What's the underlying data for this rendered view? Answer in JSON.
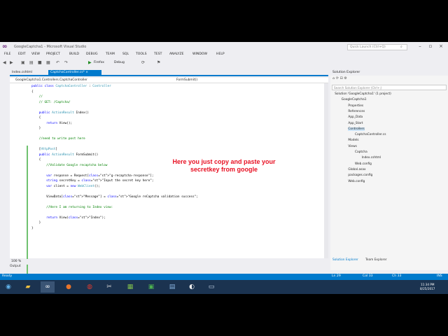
{
  "window": {
    "title": "GoogleCaptcha1 - Microsoft Visual Studio",
    "quick_launch": "Quick Launch (Ctrl+Q)"
  },
  "menu": [
    "FILE",
    "EDIT",
    "VIEW",
    "PROJECT",
    "BUILD",
    "DEBUG",
    "TEAM",
    "SQL",
    "TOOLS",
    "TEST",
    "ANALYZE",
    "WINDOW",
    "HELP"
  ],
  "toolbar": {
    "browser": "Firefox",
    "config": "Debug"
  },
  "tabs": [
    {
      "label": "Index.cshtml"
    },
    {
      "label": "CaptchaController.cs*"
    }
  ],
  "nav": {
    "left": "GoogleCaptcha1.Controllers.CaptchaController",
    "right": "FormSubmit()"
  },
  "code": [
    "public class CaptchaController : Controller",
    "{",
    "    //",
    "    // GET: /Captcha/",
    "",
    "    public ActionResult Index()",
    "    {",
    "        return View();",
    "    }",
    "",
    "    //need to write post here",
    "",
    "    [HttpPost]",
    "    public ActionResult FormSubmit()",
    "    {",
    "        //Validate Google recaptcha below",
    "",
    "        var response = Request[\"g-recaptcha-response\"];",
    "        string secretKey = \"Input the secret key here\";",
    "        var client = new WebClient();",
    "",
    "        ViewData[\"Message\"] = \"Google reCaptcha validation success\";",
    "",
    "        //Here I am returning to Index view:",
    "",
    "        return View(\"Index\");",
    "    }",
    "}"
  ],
  "overlay": "Here you just copy and paste your secretkey from google",
  "zoom": "100 %",
  "output_label": "Output",
  "solution_explorer": {
    "title": "Solution Explorer",
    "search": "Search Solution Explorer (Ctrl+;)",
    "items": [
      "Solution 'GoogleCaptcha1' (1 project)",
      "GoogleCaptcha1",
      "Properties",
      "References",
      "App_Data",
      "App_Start",
      "Controllers",
      "CaptchaController.cs",
      "Models",
      "Views",
      "Captcha",
      "Index.cshtml",
      "Web.config",
      "Global.asax",
      "packages.config",
      "Web.config"
    ],
    "tabs": [
      "Solution Explorer",
      "Team Explorer"
    ]
  },
  "status": {
    "left": "Ready",
    "ln": "Ln 29",
    "col": "Col 33",
    "ch": "Ch 33",
    "mode": "INS"
  },
  "clock": {
    "time": "11:34 PM",
    "date": "8/25/2017"
  },
  "colors": {
    "accent": "#007acc",
    "overlay": "#e81123",
    "taskbar": "#1b3350"
  }
}
